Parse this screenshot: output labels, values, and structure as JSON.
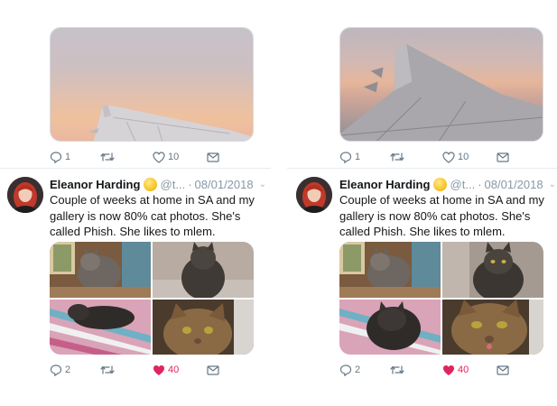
{
  "colors": {
    "icon_gray": "#657786",
    "like_red": "#e0245e",
    "name_black": "#14171a",
    "meta_gray": "#8899a6"
  },
  "columns": [
    {
      "first_tweet": {
        "media": "airplane-wing-photo",
        "actions": {
          "replies": "1",
          "likes": "10"
        }
      },
      "tweet": {
        "author_name": "Eleanor Harding",
        "author_emoji": "slightly-smiling-face-emoji",
        "handle": "@t...",
        "separator": "·",
        "date": "08/01/2018",
        "text": "Couple of weeks at home in SA and my gallery is now 80% cat photos. She's called Phish. She likes to mlem.",
        "photos": [
          "cat-by-window",
          "cat-sitting",
          "cat-on-blanket",
          "cat-closeup"
        ],
        "actions": {
          "replies": "2",
          "likes": "40"
        }
      }
    },
    {
      "first_tweet": {
        "media": "airplane-wing-photo",
        "actions": {
          "replies": "1",
          "likes": "10"
        }
      },
      "tweet": {
        "author_name": "Eleanor Harding",
        "author_emoji": "slightly-smiling-face-emoji",
        "handle": "@t...",
        "separator": "·",
        "date": "08/01/2018",
        "text": "Couple of weeks at home in SA and my gallery is now 80% cat photos. She's called Phish. She likes to mlem.",
        "photos": [
          "cat-by-window",
          "cat-sitting",
          "cat-on-blanket",
          "cat-mlem-closeup"
        ],
        "actions": {
          "replies": "2",
          "likes": "40"
        }
      }
    }
  ]
}
